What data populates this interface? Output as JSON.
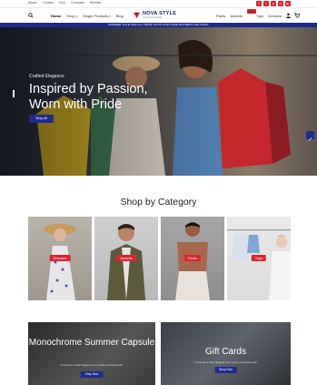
{
  "topbar": {
    "links": [
      "About",
      "Contact",
      "FAQ",
      "Compare",
      "Wishlist"
    ],
    "socials": [
      "facebook-icon",
      "twitter-icon",
      "pinterest-icon",
      "instagram-icon",
      "youtube-icon"
    ]
  },
  "header": {
    "nav": [
      "Home",
      "Shop",
      "Single Products",
      "Blog"
    ],
    "logo_name": "NOVA STYLE",
    "logo_tag": "CLOTHING STORE",
    "categories": [
      "Pants",
      "Jackets",
      "Tops",
      "Dresses"
    ],
    "tops_badge": "New"
  },
  "promo_bar": "SUMMER SALE FOR ALL SWIM SUITS AND FREE EXPRESS DELIVERY",
  "hero": {
    "eyebrow": "Crafted Elegance",
    "title": "Inspired by Passion, Worn with Pride",
    "button": "Shop All"
  },
  "category_section": {
    "title": "Shop by Category",
    "items": [
      "Dresses",
      "Jackets",
      "Pants",
      "Tops"
    ]
  },
  "promos": [
    {
      "title": "Monochrome Summer Capsule",
      "desc": "It presents a wider flagging rest of gods punctuated with.",
      "button": "Shop Now"
    },
    {
      "title": "Gift Cards",
      "desc": "It presents a wider flagging rest of gods punctuated with.",
      "button": "Shop Now"
    }
  ],
  "colors": {
    "accent": "#e0232e",
    "brand": "#1f2a8f"
  }
}
